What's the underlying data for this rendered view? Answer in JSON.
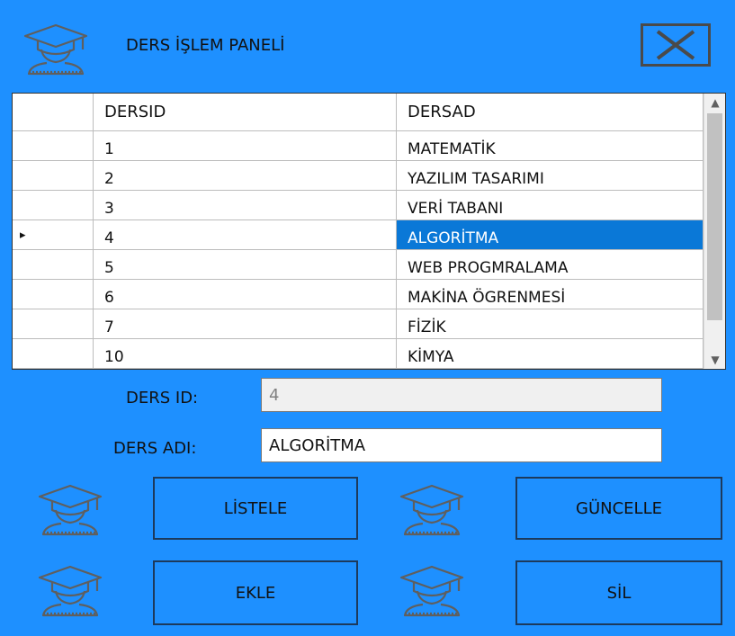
{
  "window": {
    "title": "DERS İŞLEM PANELİ"
  },
  "icons": {
    "panel_icon": "graduate-icon",
    "close": "close-icon",
    "button_icons": "graduate-icon"
  },
  "grid": {
    "columns": [
      "DERSID",
      "DERSAD"
    ],
    "rows": [
      {
        "id": "1",
        "name": "MATEMATİK"
      },
      {
        "id": "2",
        "name": "YAZILIM TASARIMI"
      },
      {
        "id": "3",
        "name": "VERİ TABANI"
      },
      {
        "id": "4",
        "name": "ALGORİTMA",
        "selected": true
      },
      {
        "id": "5",
        "name": "WEB PROGMRALAMA"
      },
      {
        "id": "6",
        "name": "MAKİNA ÖGRENMESİ"
      },
      {
        "id": "7",
        "name": "FİZİK"
      },
      {
        "id": "10",
        "name": "KİMYA"
      }
    ],
    "selected_indicator": "▸"
  },
  "form": {
    "id_label": "DERS ID:",
    "id_value": "4",
    "name_label": "DERS ADI:",
    "name_value": "ALGORİTMA"
  },
  "buttons": {
    "list": "LİSTELE",
    "update": "GÜNCELLE",
    "add": "EKLE",
    "delete": "SİL"
  },
  "colors": {
    "background": "#1e90ff",
    "selection": "#0a78d7",
    "icon": "#5f5f5f"
  }
}
